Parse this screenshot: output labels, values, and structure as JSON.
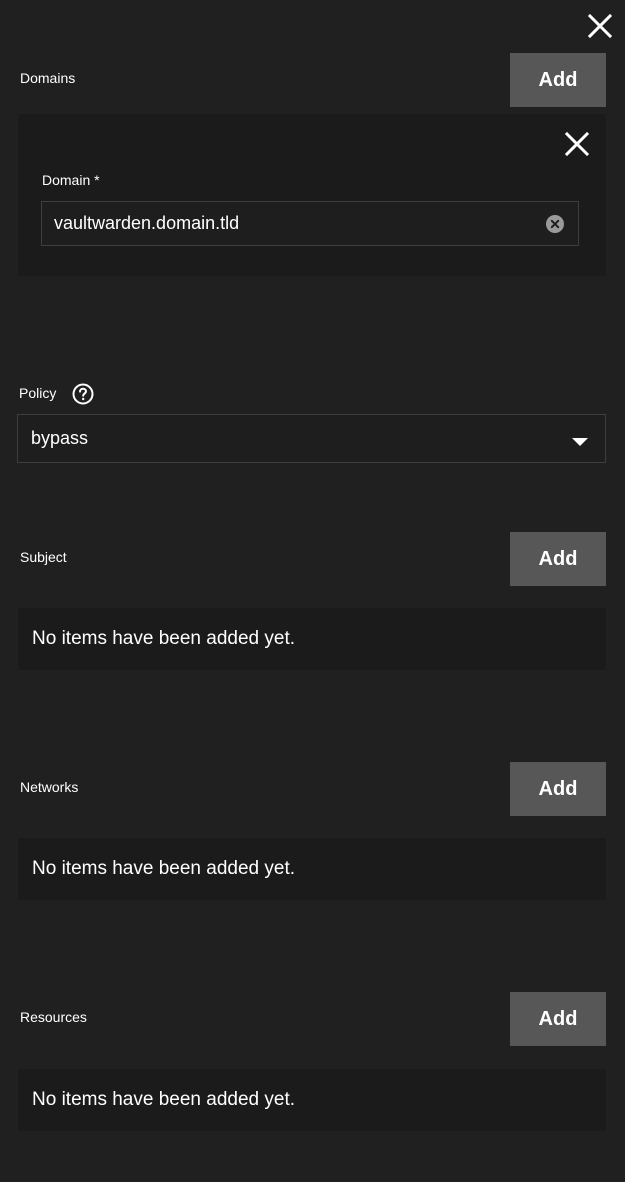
{
  "window": {
    "close_icon": "close-icon"
  },
  "domains": {
    "label": "Domains",
    "add_label": "Add",
    "item": {
      "remove_icon": "close-icon",
      "field_label": "Domain *",
      "value": "vaultwarden.domain.tld",
      "clear_icon": "clear-circle-icon"
    }
  },
  "policy": {
    "label": "Policy",
    "help_icon": "help-circle-icon",
    "selected": "bypass",
    "dropdown_icon": "caret-down-icon"
  },
  "subject": {
    "label": "Subject",
    "add_label": "Add",
    "empty_text": "No items have been added yet."
  },
  "networks": {
    "label": "Networks",
    "add_label": "Add",
    "empty_text": "No items have been added yet."
  },
  "resources": {
    "label": "Resources",
    "add_label": "Add",
    "empty_text": "No items have been added yet."
  },
  "colors": {
    "background": "#202020",
    "card": "#1b1b1b",
    "button": "#575757",
    "border": "#3e3e3e",
    "text": "#ffffff"
  }
}
